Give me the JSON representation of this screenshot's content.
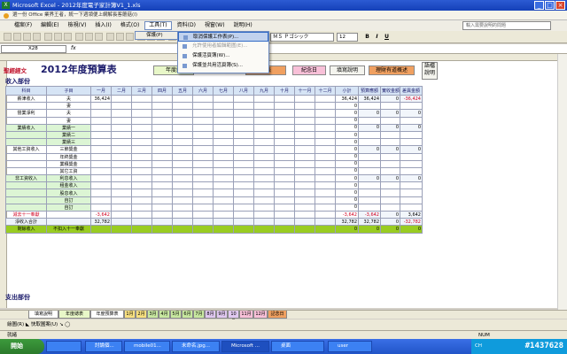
{
  "window": {
    "title": "Microsoft Excel - 2012年度電子家計簿V1_1.xls",
    "controls": [
      "_",
      "□",
      "×"
    ]
  },
  "promo": {
    "text": "選一份 Office 業界王者，統一下週領便上網解長客蘑菇(I)"
  },
  "menu": {
    "items": [
      "檔案(F)",
      "編輯(E)",
      "檢視(V)",
      "插入(I)",
      "格式(O)",
      "工具(T)",
      "資料(D)",
      "視窗(W)",
      "說明(H)"
    ],
    "active_index": 5,
    "help_placeholder": "輸入需要說明的問題"
  },
  "toolbar": {
    "font": "ＭＳ Ｐゴシック",
    "size": "12",
    "bold": "B",
    "italic": "I",
    "underline": "U"
  },
  "formula": {
    "namebox": "X28",
    "fx": "fx"
  },
  "dropdown": {
    "label": "保護(P)"
  },
  "submenu": {
    "items": [
      {
        "label": "取消保護工作表(P)...",
        "state": "highlight"
      },
      {
        "label": "允許使用者編輯範圍(E)...",
        "state": "disabled"
      },
      {
        "label": "保護活頁簿(W)...",
        "state": "normal"
      },
      {
        "label": "保護並共用活頁簿(S)...",
        "state": "normal"
      }
    ]
  },
  "header": {
    "brand": "聖經經文",
    "title": "2012年度預算表"
  },
  "badges": [
    {
      "label": "年度總",
      "bg": "#e8f7c8"
    },
    {
      "label": "情表",
      "bg": "#f0a060"
    },
    {
      "label": "紀念日",
      "bg": "#f8c0d8"
    },
    {
      "label": "填寫說明",
      "bg": "#f4f4ee"
    },
    {
      "label": "理財有道概述",
      "bg": "#f0a060"
    },
    {
      "label": "語檔說明",
      "bg": "#f4f4ee"
    }
  ],
  "sections": {
    "income": "收入部份",
    "expense": "支出部份"
  },
  "table": {
    "headers": [
      "科目",
      "子目",
      "一月",
      "二月",
      "三月",
      "四月",
      "五月",
      "六月",
      "七月",
      "八月",
      "九月",
      "十月",
      "十一月",
      "十二月",
      "小計",
      "預算應額",
      "實收金額",
      "差異金額"
    ],
    "rows": [
      [
        "薪津收入",
        "夫",
        "36,424",
        "",
        "",
        "",
        "",
        "",
        "",
        "",
        "",
        "",
        "",
        "",
        "36,424",
        "36,424",
        "0",
        "-36,424"
      ],
      [
        "",
        "妻",
        "",
        "",
        "",
        "",
        "",
        "",
        "",
        "",
        "",
        "",
        "",
        "",
        "0",
        "",
        "",
        ""
      ],
      [
        "營業淨利",
        "夫",
        "",
        "",
        "",
        "",
        "",
        "",
        "",
        "",
        "",
        "",
        "",
        "",
        "0",
        "0",
        "0",
        "0"
      ],
      [
        "",
        "妻",
        "",
        "",
        "",
        "",
        "",
        "",
        "",
        "",
        "",
        "",
        "",
        "",
        "0",
        "",
        "",
        ""
      ],
      [
        "業績收入",
        "業績一",
        "",
        "",
        "",
        "",
        "",
        "",
        "",
        "",
        "",
        "",
        "",
        "",
        "0",
        "0",
        "0",
        "0"
      ],
      [
        "",
        "業績二",
        "",
        "",
        "",
        "",
        "",
        "",
        "",
        "",
        "",
        "",
        "",
        "",
        "0",
        "",
        "",
        ""
      ],
      [
        "",
        "業績三",
        "",
        "",
        "",
        "",
        "",
        "",
        "",
        "",
        "",
        "",
        "",
        "",
        "0",
        "",
        "",
        ""
      ],
      [
        "其他工資收入",
        "三節獎金",
        "",
        "",
        "",
        "",
        "",
        "",
        "",
        "",
        "",
        "",
        "",
        "",
        "0",
        "0",
        "0",
        "0"
      ],
      [
        "",
        "年終獎金",
        "",
        "",
        "",
        "",
        "",
        "",
        "",
        "",
        "",
        "",
        "",
        "",
        "0",
        "",
        "",
        ""
      ],
      [
        "",
        "業積獎金",
        "",
        "",
        "",
        "",
        "",
        "",
        "",
        "",
        "",
        "",
        "",
        "",
        "0",
        "",
        "",
        ""
      ],
      [
        "",
        "其它工資",
        "",
        "",
        "",
        "",
        "",
        "",
        "",
        "",
        "",
        "",
        "",
        "",
        "0",
        "",
        "",
        ""
      ],
      [
        "非工資收入",
        "利息收入",
        "",
        "",
        "",
        "",
        "",
        "",
        "",
        "",
        "",
        "",
        "",
        "",
        "0",
        "0",
        "0",
        "0"
      ],
      [
        "",
        "租金收入",
        "",
        "",
        "",
        "",
        "",
        "",
        "",
        "",
        "",
        "",
        "",
        "",
        "0",
        "",
        "",
        ""
      ],
      [
        "",
        "股息收入",
        "",
        "",
        "",
        "",
        "",
        "",
        "",
        "",
        "",
        "",
        "",
        "",
        "0",
        "",
        "",
        ""
      ],
      [
        "",
        "自訂",
        "",
        "",
        "",
        "",
        "",
        "",
        "",
        "",
        "",
        "",
        "",
        "",
        "0",
        "",
        "",
        ""
      ],
      [
        "",
        "自訂",
        "",
        "",
        "",
        "",
        "",
        "",
        "",
        "",
        "",
        "",
        "",
        "",
        "0",
        "",
        "",
        ""
      ],
      [
        "減去十一奉獻",
        "",
        "-3,642",
        "",
        "",
        "",
        "",
        "",
        "",
        "",
        "",
        "",
        "",
        "",
        "-3,642",
        "-3,642",
        "0",
        "3,642"
      ],
      [
        "淨收入合計",
        "",
        "32,782",
        "",
        "",
        "",
        "",
        "",
        "",
        "",
        "",
        "",
        "",
        "",
        "32,782",
        "32,782",
        "0",
        "-32,782"
      ],
      [
        "剩餘收入",
        "不扣入十一奉獻",
        "",
        "",
        "",
        "",
        "",
        "",
        "",
        "",
        "",
        "",
        "",
        "",
        "0",
        "0",
        "0",
        "0"
      ]
    ]
  },
  "sheet_tabs": [
    {
      "label": "填寫說明",
      "bg": "#ffffff"
    },
    {
      "label": "年度總表",
      "bg": "#e8f7c8"
    },
    {
      "label": "年度預算表",
      "bg": "#ffffff"
    },
    {
      "label": "1月",
      "bg": "#f8e080"
    },
    {
      "label": "2月",
      "bg": "#f8e080"
    },
    {
      "label": "3月",
      "bg": "#c8e8a0"
    },
    {
      "label": "4月",
      "bg": "#c8e8a0"
    },
    {
      "label": "5月",
      "bg": "#c8e8a0"
    },
    {
      "label": "6月",
      "bg": "#c8e8a0"
    },
    {
      "label": "7月",
      "bg": "#c8e8a0"
    },
    {
      "label": "8月",
      "bg": "#e0c8f0"
    },
    {
      "label": "9月",
      "bg": "#e0c8f0"
    },
    {
      "label": "10月",
      "bg": "#e0c8f0"
    },
    {
      "label": "11月",
      "bg": "#f8c0d8"
    },
    {
      "label": "12月",
      "bg": "#f8c0d8"
    },
    {
      "label": "記念日",
      "bg": "#f0a060"
    }
  ],
  "drawbar": {
    "text": "繪圖(R)  ◣  快取圖案(U)  ↘  ◯"
  },
  "status": {
    "left": "就緒",
    "num": "NUM"
  },
  "taskbar": {
    "start": "開始",
    "tasks": [
      {
        "label": "",
        "active": false
      },
      {
        "label": "討論個...",
        "active": false
      },
      {
        "label": "mobile01...",
        "active": false
      },
      {
        "label": "未命名.jpg...",
        "active": false
      },
      {
        "label": "Microsoft ...",
        "active": true
      },
      {
        "label": "桌面",
        "active": false
      },
      {
        "label": "user",
        "active": false
      }
    ],
    "tray": "CH",
    "watermark": "#1437628"
  },
  "colors": {
    "title_blue": "#1440b8",
    "header_fill": "#d6e4f5",
    "green_fill": "#dcf5d4",
    "olive": "#99cc22",
    "negative": "#d00020"
  }
}
